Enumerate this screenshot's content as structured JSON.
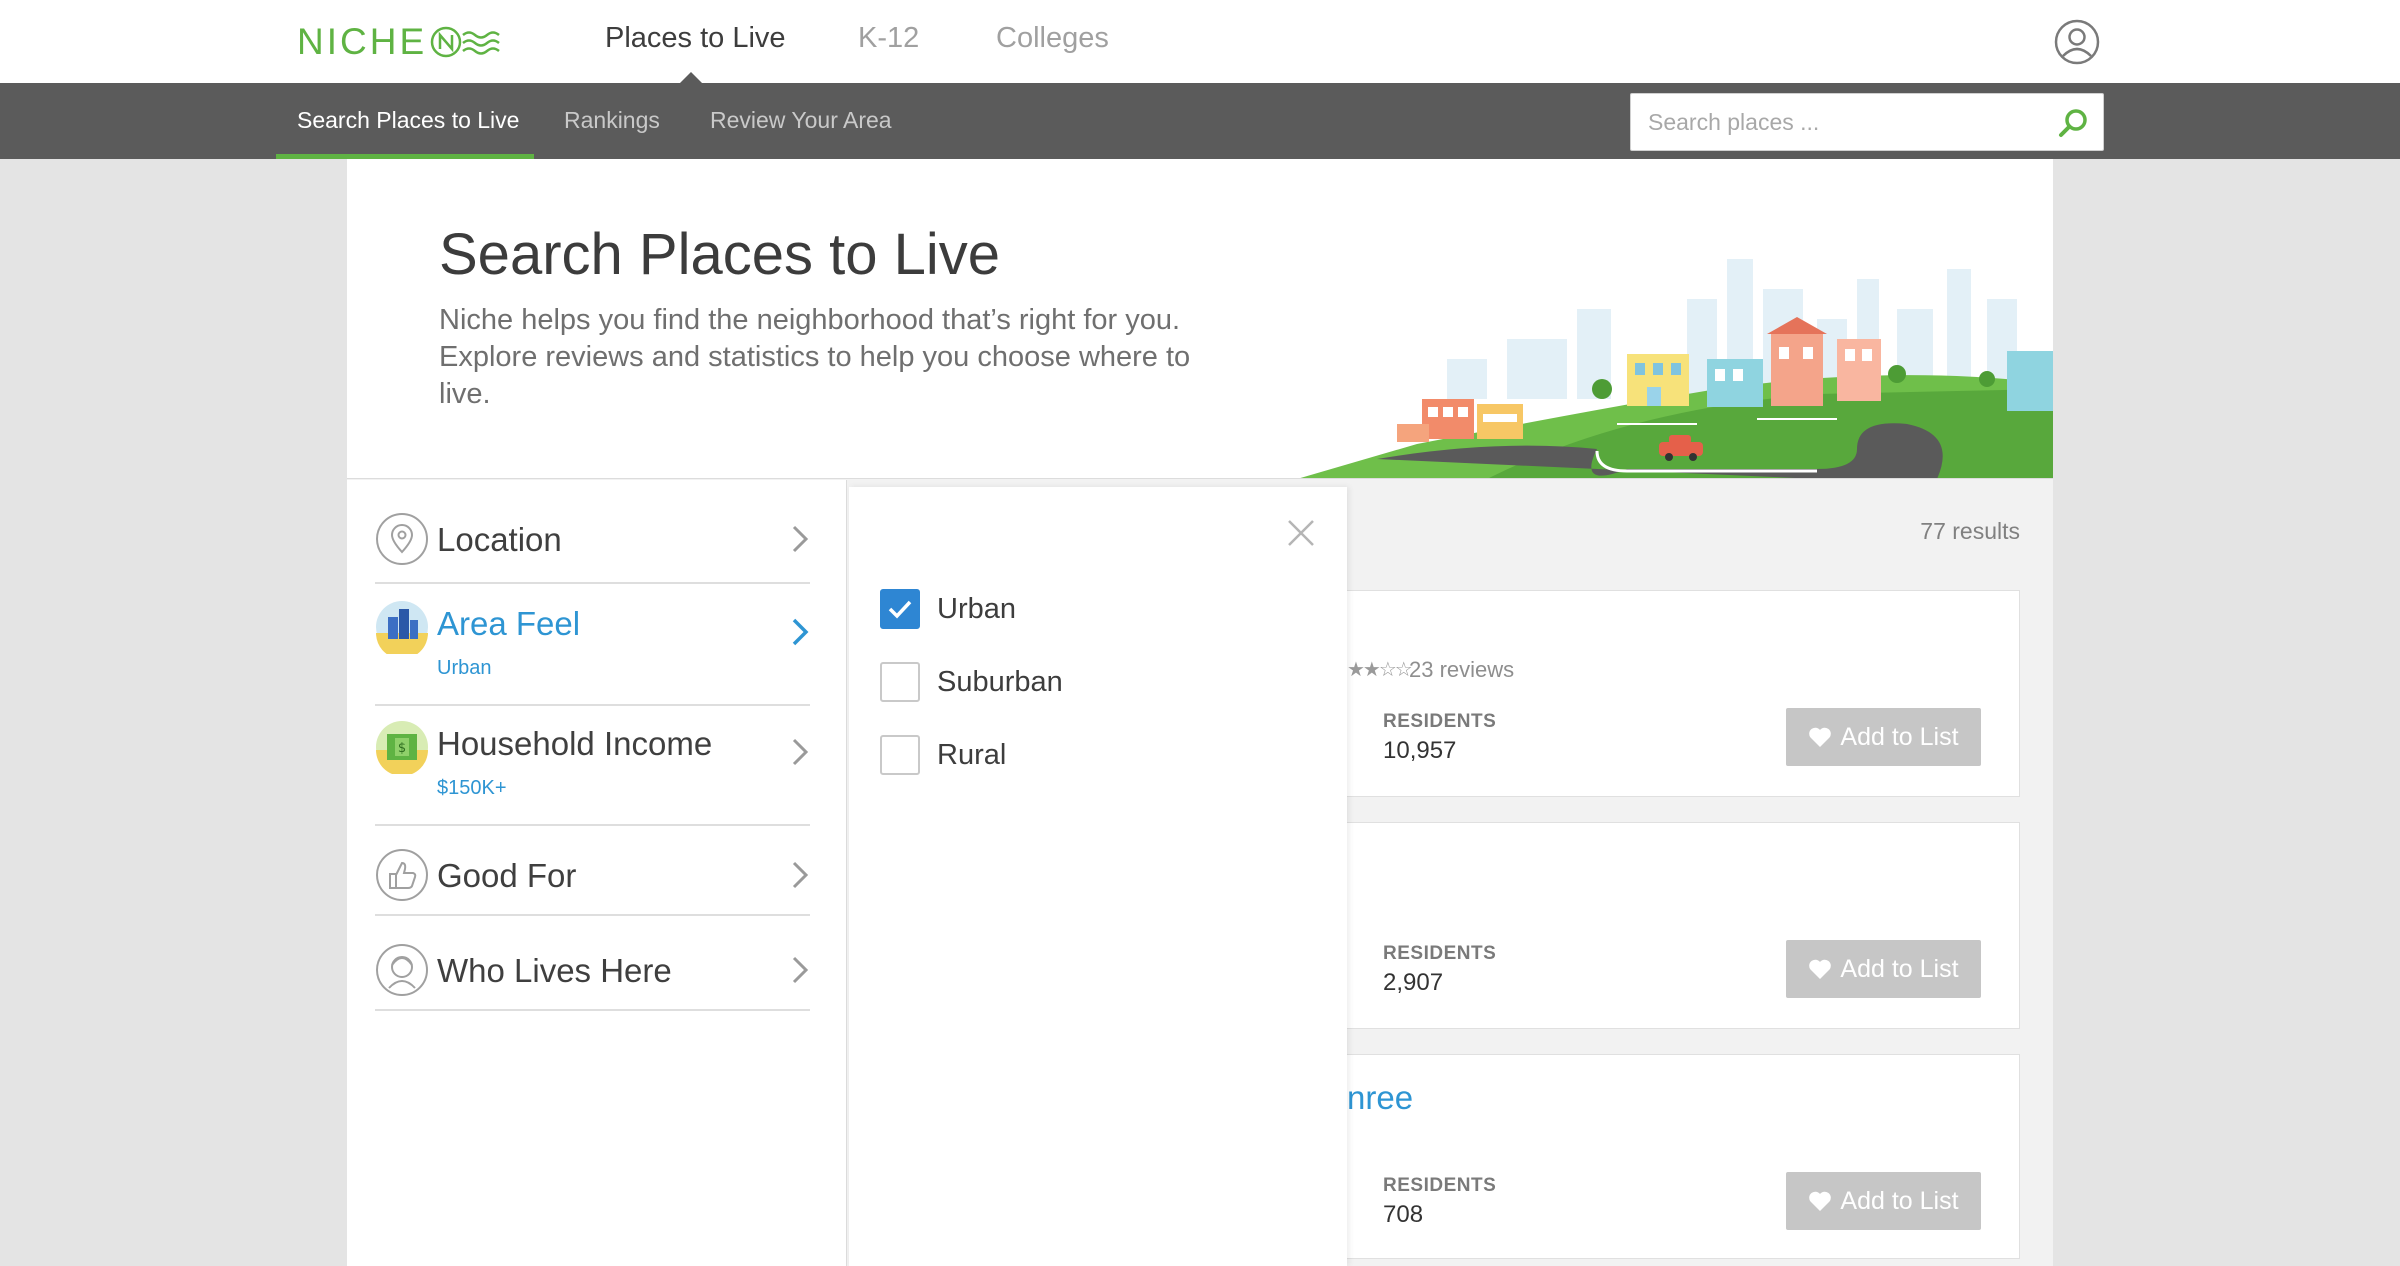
{
  "topbar": {
    "logo_text": "NICHE",
    "nav": [
      {
        "label": "Places to Live",
        "active": true
      },
      {
        "label": "K-12",
        "active": false
      },
      {
        "label": "Colleges",
        "active": false
      }
    ],
    "account_icon": "user-circle-icon"
  },
  "subbar": {
    "nav": [
      {
        "label": "Search Places to Live",
        "active": true
      },
      {
        "label": "Rankings",
        "active": false
      },
      {
        "label": "Review Your Area",
        "active": false
      }
    ],
    "search": {
      "placeholder": "Search places ...",
      "value": ""
    },
    "accent_color": "#5fb343"
  },
  "hero": {
    "title": "Search Places to Live",
    "description": "Niche helps you find the neighborhood that’s right for you. Explore reviews and statistics to help you choose where to live."
  },
  "filters": [
    {
      "label": "Location",
      "sub": "",
      "icon": "map-pin-icon",
      "active": false
    },
    {
      "label": "Area Feel",
      "sub": "Urban",
      "icon": "city-buildings-icon",
      "active": true
    },
    {
      "label": "Household Income",
      "sub": "$150K+",
      "icon": "money-bill-icon",
      "active": false
    },
    {
      "label": "Good For",
      "sub": "",
      "icon": "thumbs-up-icon",
      "active": false
    },
    {
      "label": "Who Lives Here",
      "sub": "",
      "icon": "person-face-icon",
      "active": false
    }
  ],
  "options_panel": {
    "options": [
      {
        "label": "Urban",
        "checked": true
      },
      {
        "label": "Suburban",
        "checked": false
      },
      {
        "label": "Rural",
        "checked": false
      }
    ]
  },
  "results": {
    "count_text": "77 results",
    "items": [
      {
        "title": "",
        "reviews": "23 reviews",
        "residents_label": "RESIDENTS",
        "residents": "10,957",
        "add_label": "Add to List"
      },
      {
        "title": "",
        "reviews": "",
        "residents_label": "RESIDENTS",
        "residents": "2,907",
        "add_label": "Add to List"
      },
      {
        "title": "nree",
        "reviews": "",
        "residents_label": "RESIDENTS",
        "residents": "708",
        "add_label": "Add to List"
      }
    ]
  },
  "colors": {
    "link_blue": "#2e95d3",
    "checkbox_blue": "#2e86d3",
    "button_gray": "#c6c6c6",
    "subbar_gray": "#5b5b5b"
  }
}
